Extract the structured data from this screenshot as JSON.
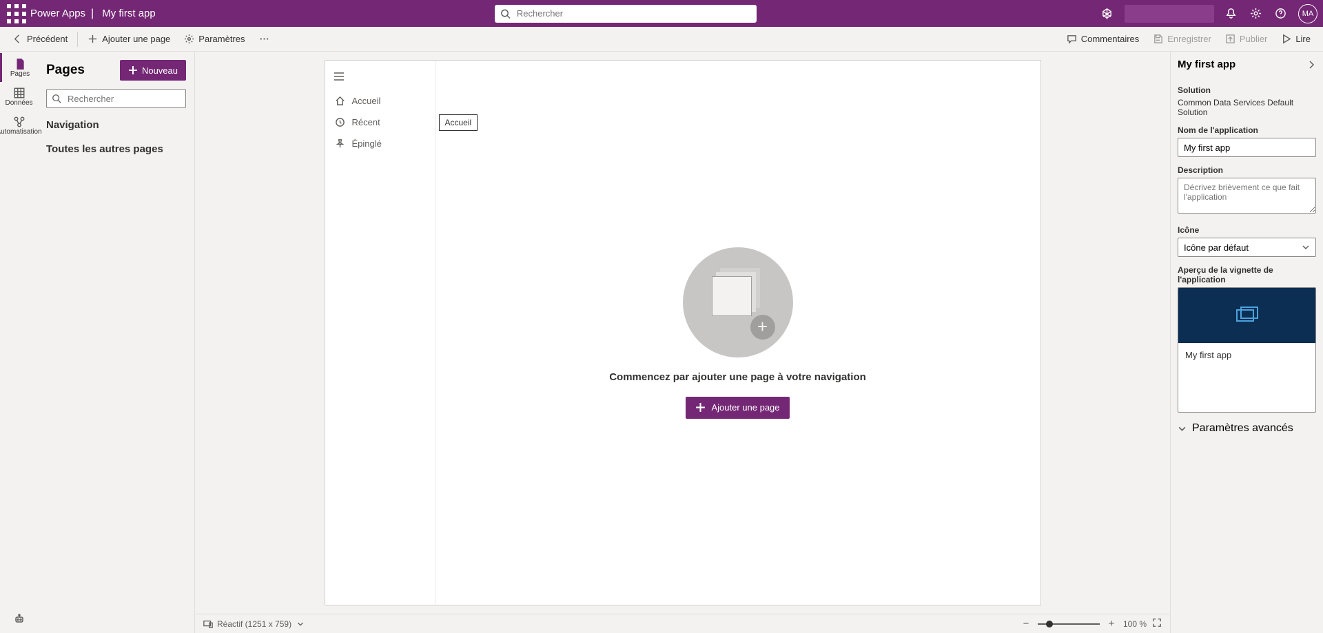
{
  "header": {
    "product": "Power Apps",
    "app_name": "My first app",
    "search_placeholder": "Rechercher",
    "avatar_initials": "MA"
  },
  "cmdbar": {
    "back": "Précédent",
    "add_page": "Ajouter une page",
    "settings": "Paramètres",
    "comments": "Commentaires",
    "save": "Enregistrer",
    "publish": "Publier",
    "play": "Lire"
  },
  "rail": {
    "pages": "Pages",
    "data": "Données",
    "automation": "Automatisation"
  },
  "pages_panel": {
    "title": "Pages",
    "new_btn": "Nouveau",
    "search_placeholder": "Rechercher",
    "group_nav": "Navigation",
    "group_other": "Toutes les autres pages"
  },
  "device": {
    "nav": {
      "home": "Accueil",
      "recent": "Récent",
      "pinned": "Épinglé",
      "tooltip": "Accueil"
    },
    "empty_title": "Commencez par ajouter une page à votre navigation",
    "add_page_btn": "Ajouter une page"
  },
  "status": {
    "responsive": "Réactif (1251 x 759)",
    "zoom": "100 %"
  },
  "props": {
    "title": "My first app",
    "solution_label": "Solution",
    "solution_value": "Common Data Services Default Solution",
    "appname_label": "Nom de l'application",
    "appname_value": "My first app",
    "description_label": "Description",
    "description_placeholder": "Décrivez brièvement ce que fait l'application",
    "icon_label": "Icône",
    "icon_value": "Icône par défaut",
    "thumb_label": "Aperçu de la vignette de l'application",
    "thumb_caption": "My first app",
    "advanced": "Paramètres avancés"
  }
}
